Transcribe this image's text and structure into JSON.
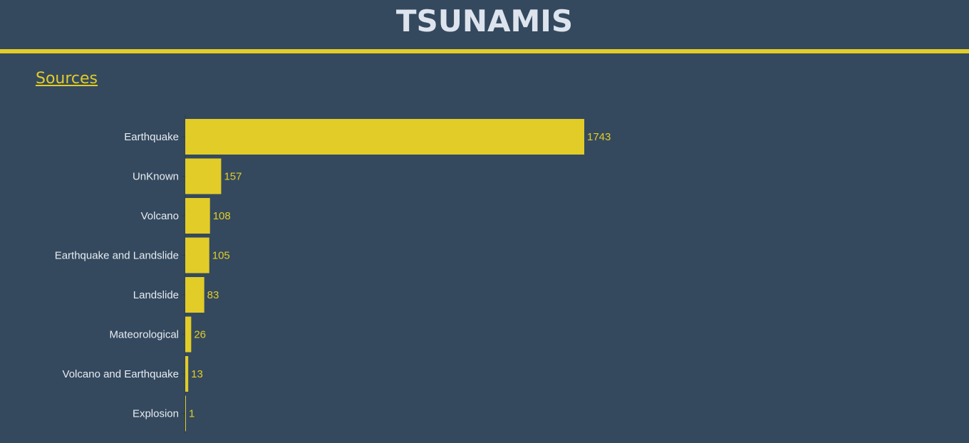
{
  "header": {
    "title": "TSUNAMIS"
  },
  "section": {
    "link_label": "Sources"
  },
  "colors": {
    "background": "#34495e",
    "accent": "#e2cc28",
    "text": "#e8ecf2"
  },
  "chart_data": {
    "type": "bar",
    "orientation": "horizontal",
    "categories": [
      "Earthquake",
      "UnKnown",
      "Volcano",
      "Earthquake and Landslide",
      "Landslide",
      "Mateorological",
      "Volcano and Earthquake",
      "Explosion"
    ],
    "values": [
      1743,
      157,
      108,
      105,
      83,
      26,
      13,
      1
    ],
    "title": "",
    "xlabel": "",
    "ylabel": "",
    "data_labels": true,
    "grid": false,
    "legend": "none"
  }
}
